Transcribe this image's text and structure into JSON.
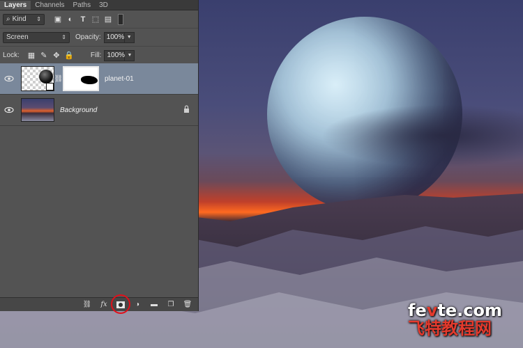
{
  "tabs": [
    {
      "label": "Layers",
      "active": true
    },
    {
      "label": "Channels",
      "active": false
    },
    {
      "label": "Paths",
      "active": false
    },
    {
      "label": "3D",
      "active": false
    }
  ],
  "filter": {
    "kind_label": "Kind",
    "filter_icons": [
      "image-filter-icon",
      "adjustment-filter-icon",
      "type-filter-icon",
      "shape-filter-icon",
      "smart-object-filter-icon",
      "filter-toggle"
    ]
  },
  "blend": {
    "mode": "Screen",
    "opacity_label": "Opacity:",
    "opacity_value": "100%"
  },
  "lock_row": {
    "lock_label": "Lock:",
    "fill_label": "Fill:",
    "fill_value": "100%"
  },
  "layers": [
    {
      "name": "planet-01",
      "selected": true,
      "has_mask": true,
      "visible": true
    },
    {
      "name": "Background",
      "selected": false,
      "locked": true,
      "visible": true
    }
  ],
  "bottom_bar": {
    "fx_label": "fx",
    "highlighted_button": "add-layer-mask-button"
  },
  "watermark": {
    "line1_prefix": "fe",
    "line1_red": "v",
    "line1_suffix": "te.com",
    "line2": "飞特教程网"
  },
  "colors": {
    "panel_bg": "#535353",
    "selected_layer": "#7a889b",
    "highlight_circle": "#e1101a",
    "watermark_red": "#e33a2d"
  }
}
